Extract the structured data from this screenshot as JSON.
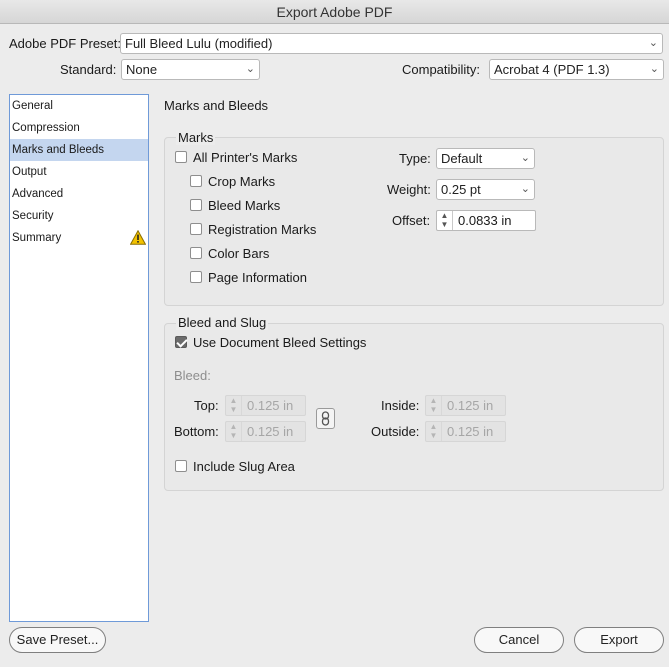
{
  "window": {
    "title": "Export Adobe PDF"
  },
  "top": {
    "preset_label": "Adobe PDF Preset:",
    "preset_value": "Full Bleed Lulu (modified)",
    "standard_label": "Standard:",
    "standard_value": "None",
    "compat_label": "Compatibility:",
    "compat_value": "Acrobat 4 (PDF 1.3)"
  },
  "sidebar": {
    "items": [
      {
        "label": "General"
      },
      {
        "label": "Compression"
      },
      {
        "label": "Marks and Bleeds"
      },
      {
        "label": "Output"
      },
      {
        "label": "Advanced"
      },
      {
        "label": "Security"
      },
      {
        "label": "Summary"
      }
    ],
    "selected_index": 2,
    "warning_icon": "warning-triangle-icon"
  },
  "panel": {
    "title": "Marks and Bleeds"
  },
  "marks": {
    "title": "Marks",
    "all_printers": "All Printer's Marks",
    "crop": "Crop Marks",
    "bleed": "Bleed Marks",
    "registration": "Registration Marks",
    "color_bars": "Color Bars",
    "page_info": "Page Information",
    "type_label": "Type:",
    "type_value": "Default",
    "weight_label": "Weight:",
    "weight_value": "0.25 pt",
    "offset_label": "Offset:",
    "offset_value": "0.0833 in"
  },
  "bleed": {
    "title": "Bleed and Slug",
    "use_doc": "Use Document Bleed Settings",
    "use_doc_checked": true,
    "bleed_label": "Bleed:",
    "top_label": "Top:",
    "top_value": "0.125 in",
    "bottom_label": "Bottom:",
    "bottom_value": "0.125 in",
    "inside_label": "Inside:",
    "inside_value": "0.125 in",
    "outside_label": "Outside:",
    "outside_value": "0.125 in",
    "slug": "Include Slug Area"
  },
  "buttons": {
    "save_preset": "Save Preset...",
    "cancel": "Cancel",
    "export": "Export"
  },
  "colors": {
    "selection": "#c4d6ef",
    "sidebar_border": "#6f9ad8",
    "warning": "#f2c200"
  }
}
